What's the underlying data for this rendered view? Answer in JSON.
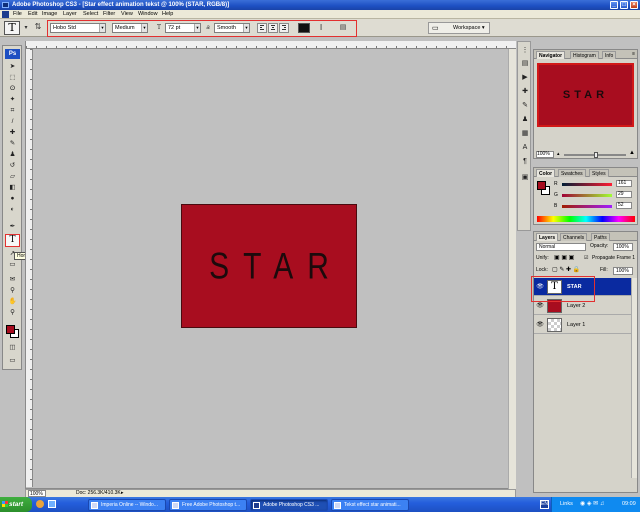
{
  "window": {
    "title": "Adobe Photoshop CS3 - [Star effect animation tekst @ 100% (STAR, RGB/8)]"
  },
  "menu": {
    "items": [
      "File",
      "Edit",
      "Image",
      "Layer",
      "Select",
      "Filter",
      "View",
      "Window",
      "Help"
    ]
  },
  "options": {
    "tool_glyph": "T",
    "font_family": "Hobo Std",
    "font_style": "Medium",
    "font_size": "72 pt",
    "aa_label": "a",
    "aa_mode": "Smooth",
    "workspace": "Workspace ▾"
  },
  "toolbox": {
    "ps_label": "Ps",
    "type_glyph": "T",
    "tooltip": "Horizontal Type Tool (T)"
  },
  "document": {
    "canvas_text": "STAR",
    "zoom": "100%",
    "doc_info": "Doc: 256.3K/410.3K"
  },
  "navigator": {
    "tabs": [
      "Navigator",
      "Histogram",
      "Info"
    ],
    "thumb_text": "STAR",
    "zoom": "100%"
  },
  "color_panel": {
    "tabs": [
      "Color",
      "Swatches",
      "Styles"
    ],
    "r_label": "R",
    "g_label": "G",
    "b_label": "B",
    "r": "161",
    "g": "29",
    "b": "52",
    "fg_color": "#a70c1e"
  },
  "layers_panel": {
    "tabs": [
      "Layers",
      "Channels",
      "Paths"
    ],
    "blend_mode": "Normal",
    "opacity_label": "Opacity:",
    "opacity": "100%",
    "unify_label": "Unify:",
    "propagate_label": "Propagate Frame 1",
    "lock_label": "Lock:",
    "fill_label": "Fill:",
    "fill": "100%",
    "layers": [
      {
        "name": "STAR",
        "selected": true
      },
      {
        "name": "Layer 2",
        "selected": false
      },
      {
        "name": "Layer 1",
        "selected": false
      }
    ]
  },
  "taskbar": {
    "start": "start",
    "tasks": [
      "Imperia Online -- Windo...",
      "Free Adobe Photoshop t...",
      "Adobe Photoshop CS3 ...",
      "Tekst effect star animati..."
    ],
    "tray_label": "Links",
    "clock": "09:09"
  },
  "colors": {
    "accent_red": "#a80d1f",
    "selection_blue": "#0a2aa0",
    "highlight_box": "#e23030"
  }
}
